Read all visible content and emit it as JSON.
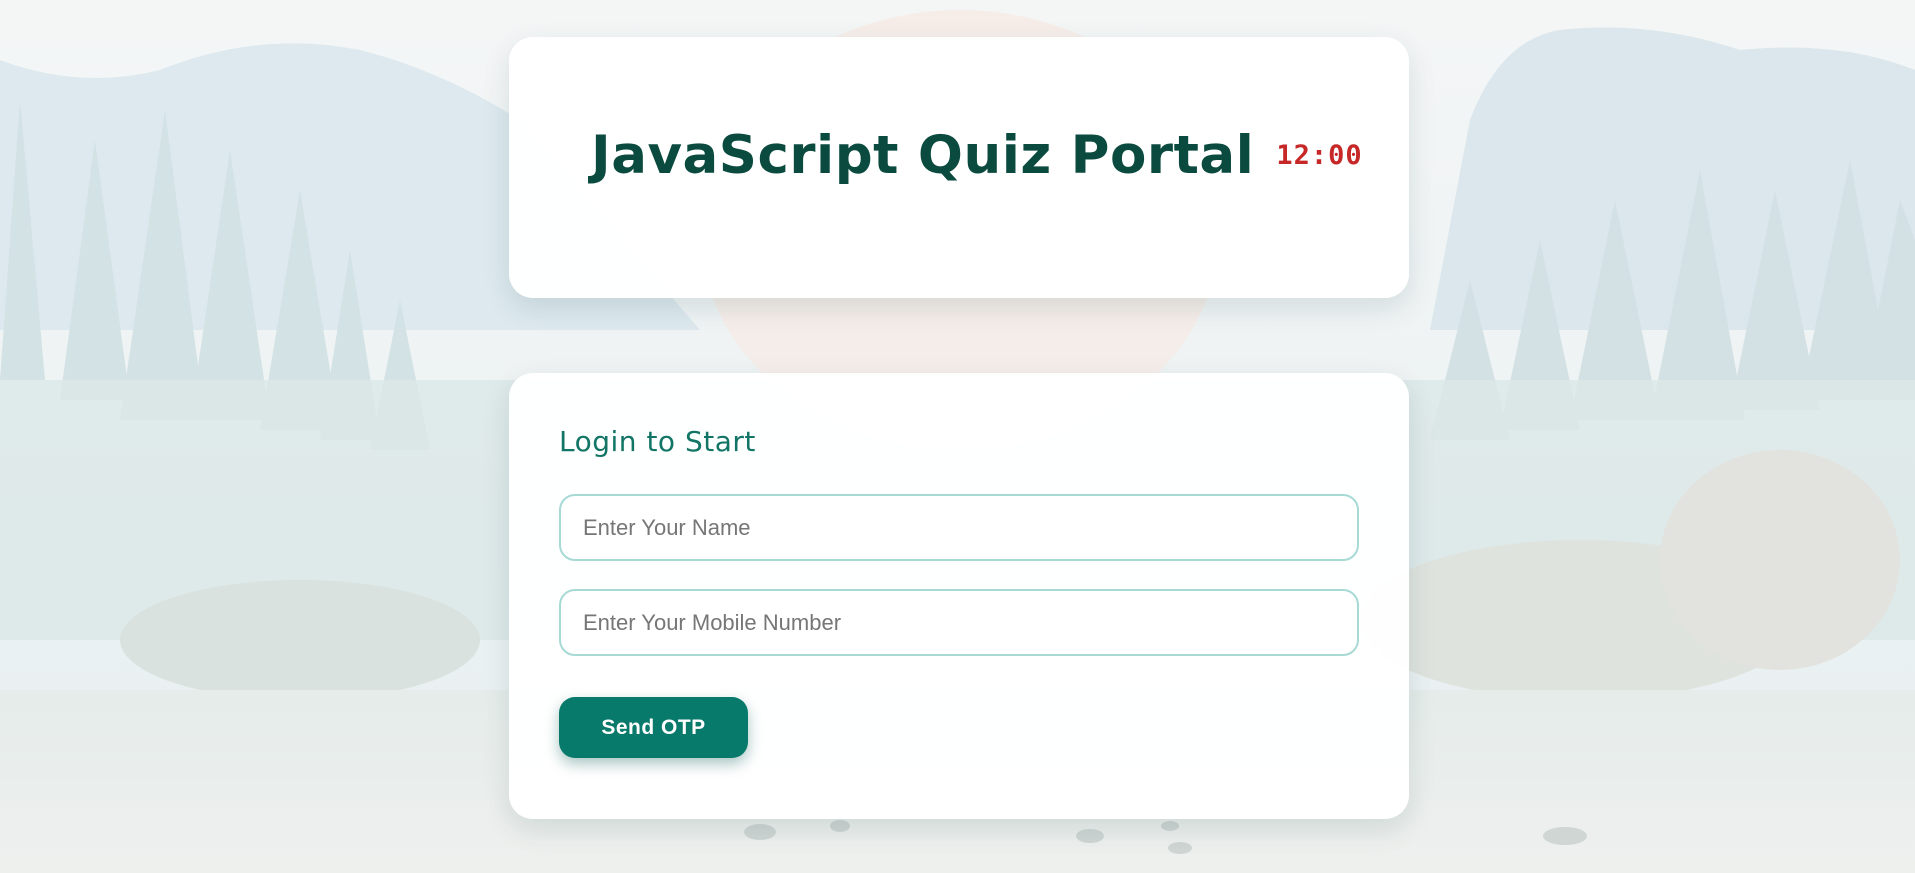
{
  "header": {
    "title": "JavaScript Quiz Portal",
    "timer": "12:00"
  },
  "login": {
    "heading": "Login to Start",
    "name_placeholder": "Enter Your Name",
    "mobile_placeholder": "Enter Your Mobile Number",
    "send_otp_label": "Send OTP"
  },
  "theme": {
    "title_color": "#0b4a3f",
    "timer_color": "#c62828",
    "accent_color": "#087a6b",
    "heading_color": "#137565",
    "input_border_color": "#a7d9d5"
  },
  "background": {
    "description_icon": "forest-mountain-background"
  }
}
